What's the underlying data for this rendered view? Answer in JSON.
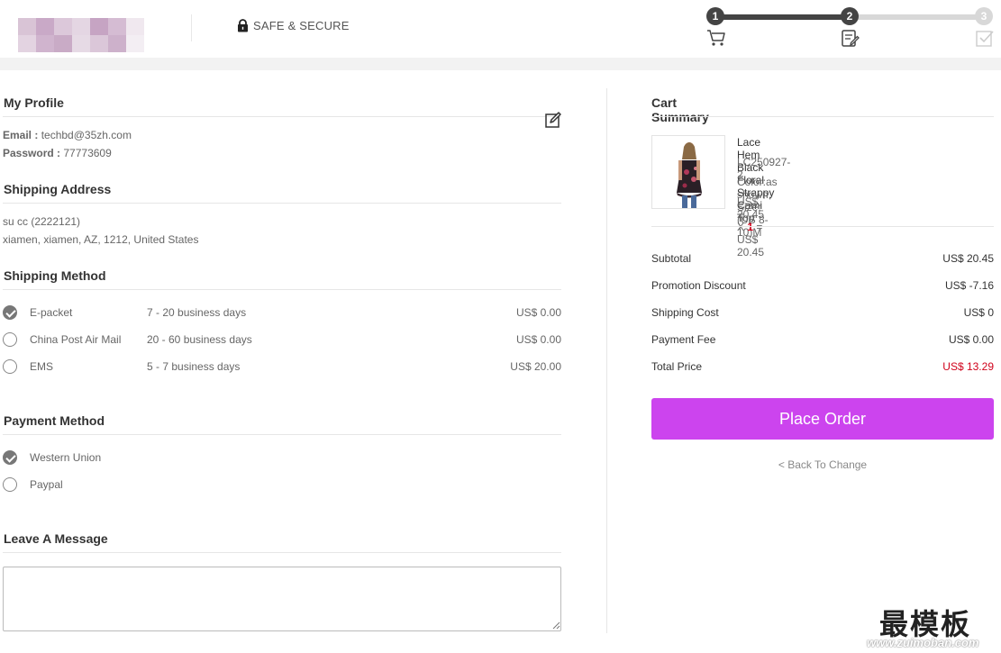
{
  "header": {
    "secure_label": "SAFE & SECURE",
    "steps": [
      {
        "number": "1",
        "icon": "cart-icon",
        "state": "done"
      },
      {
        "number": "2",
        "icon": "order-form-icon",
        "state": "current"
      },
      {
        "number": "3",
        "icon": "checkbox-done-icon",
        "state": "pending"
      }
    ]
  },
  "profile": {
    "title": "My Profile",
    "email_label": "Email :",
    "email_value": "techbd@35zh.com",
    "password_label": "Password :",
    "password_value": "77773609"
  },
  "shipping_address": {
    "title": "Shipping Address",
    "name_line": "su cc (2222121)",
    "address_line": "xiamen, xiamen, AZ, 1212, United States"
  },
  "shipping_method": {
    "title": "Shipping Method",
    "options": [
      {
        "name": "E-packet",
        "days": "7 - 20 business days",
        "price": "US$ 0.00",
        "checked": true
      },
      {
        "name": "China Post Air Mail",
        "days": "20 - 60 business days",
        "price": "US$ 0.00",
        "checked": false
      },
      {
        "name": "EMS",
        "days": "5 - 7 business days",
        "price": "US$ 20.00",
        "checked": false
      }
    ]
  },
  "payment_method": {
    "title": "Payment Method",
    "options": [
      {
        "name": "Western Union",
        "checked": true
      },
      {
        "name": "Paypal",
        "checked": false
      }
    ]
  },
  "message": {
    "title": "Leave A Message",
    "value": ""
  },
  "cart": {
    "title": "Cart Summary",
    "product": {
      "name": "Lace Hem Black Floral Strappy Cami Top",
      "sku": "LC250927-2",
      "options": "Color:as shown, Size:(US 8-10)M",
      "unit_price": "US$ 20.45 X",
      "quantity": "1",
      "line_total": "= US$ 20.45"
    },
    "summary": [
      {
        "label": "Subtotal",
        "value": "US$  20.45"
      },
      {
        "label": "Promotion Discount",
        "value": "US$  -7.16"
      },
      {
        "label": "Shipping Cost",
        "value": "US$  0"
      },
      {
        "label": "Payment Fee",
        "value": "US$  0.00"
      },
      {
        "label": "Total Price",
        "value": "US$  13.29"
      }
    ],
    "place_order_label": "Place Order",
    "back_label": "< Back To Change"
  },
  "watermark": {
    "cn": "最模板",
    "url": "www.zuimoban.com"
  },
  "colors": {
    "accent_button": "#cc44ee",
    "price_red": "#d0021b",
    "step_active": "#444444",
    "step_inactive": "#d8d8d8"
  }
}
